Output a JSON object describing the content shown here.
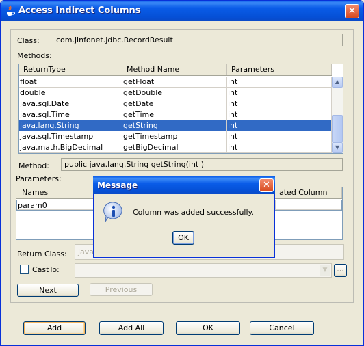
{
  "window": {
    "title": "Access Indirect Columns",
    "close_glyph": "✕",
    "app_icon": "java-cup-icon"
  },
  "class_row": {
    "label": "Class:",
    "value": "com.jinfonet.jdbc.RecordResult"
  },
  "methods": {
    "label": "Methods:",
    "headers": [
      "ReturnType",
      "Method Name",
      "Parameters"
    ],
    "rows": [
      [
        "float",
        "getFloat",
        "int"
      ],
      [
        "double",
        "getDouble",
        "int"
      ],
      [
        "java.sql.Date",
        "getDate",
        "int"
      ],
      [
        "java.sql.Time",
        "getTime",
        "int"
      ],
      [
        "java.lang.String",
        "getString",
        "int"
      ],
      [
        "java.sql.Timestamp",
        "getTimestamp",
        "int"
      ],
      [
        "java.math.BigDecimal",
        "getBigDecimal",
        "int"
      ]
    ],
    "selected_index": 4
  },
  "method_row": {
    "label": "Method:",
    "value": "public java.lang.String getString(int )"
  },
  "parameters": {
    "label": "Parameters:",
    "headers": [
      "Names",
      "ated Column"
    ],
    "rows": [
      [
        "param0",
        ""
      ]
    ]
  },
  "return_class": {
    "label": "Return Class:",
    "value": "java"
  },
  "cast_to": {
    "label": "CastTo:",
    "checked": false,
    "value": "",
    "browse_label": "..."
  },
  "nav": {
    "next": "Next",
    "previous": "Previous"
  },
  "footer": {
    "add": "Add",
    "add_all": "Add All",
    "ok": "OK",
    "cancel": "Cancel"
  },
  "message_dialog": {
    "title": "Message",
    "close_glyph": "✕",
    "text": "Column was added successfully.",
    "ok": "OK",
    "icon": "info-icon"
  }
}
